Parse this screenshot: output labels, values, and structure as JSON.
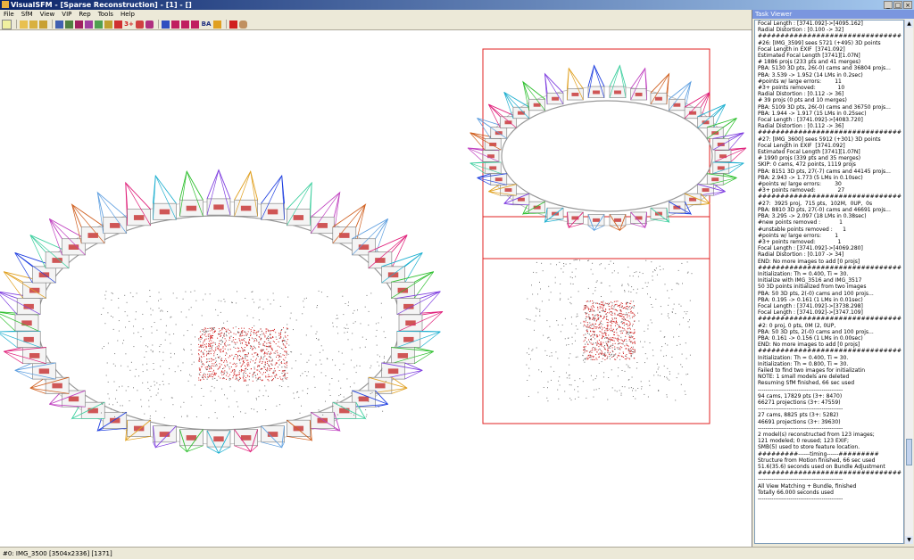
{
  "window": {
    "title": "VisualSFM - [Sparse Reconstruction] - [1] - []",
    "minimize_label": "_",
    "maximize_label": "□",
    "close_label": "×"
  },
  "menu": [
    "File",
    "SfM",
    "View",
    "VIP",
    "Rep",
    "Tools",
    "Help"
  ],
  "toolbar": {
    "icon_names": [
      "notepad-icon",
      "open-folder-icon",
      "open-multi-icon",
      "open-pairs-icon",
      "save-icon",
      "match-icon",
      "pair-icon",
      "camera-icon",
      "tag-icon",
      "lock-icon",
      "delete-icon",
      "reconstruct-plus-icon",
      "sparse-icon",
      "dense-icon",
      "shuffle-icon",
      "play-icon",
      "fast-forward-icon",
      "next-icon",
      "ba-icon",
      "compute-icon",
      "pause-icon",
      "hand-icon"
    ],
    "text_glyphs": {
      "reconstruct": "3+",
      "ba": "BA"
    }
  },
  "status_bar": {
    "text": "#0: IMG_3500 [3504x2336] [1371]"
  },
  "task_viewer": {
    "title": "Task Viewer",
    "log_lines": [
      "Focal Length : [3741.092]->[4095.162]",
      "Radial Distortion : [0.100 -> 32]",
      "",
      "################################",
      "#26: [IMG_3599] sees 5721 (+495) 3D points",
      "Focal Length in EXIF  [3741.092]",
      "Estimated Focal Length [3741][1.07N]",
      "# 1886 projs (233 pts and 41 merges)",
      "PBA: 5130 3D pts, 26(-0) cams and 36804 projs...",
      "PBA: 3.539 -> 1.952 (14 LMs in 0.2sec)",
      "#points w/ large errors:        11",
      "#3+ points removed:             10",
      "Radial Distortion : [0.112 -> 36]",
      "# 39 projs (0 pts and 10 merges)",
      "PBA: 5109 3D pts, 26(-0) cams and 36750 projs...",
      "PBA: 1.944 -> 1.917 (15 LMs in 0.25sec)",
      "Focal Length : [3741.092]->[4083.720]",
      "Radial Distortion : [0.112 -> 36]",
      "",
      "################################",
      "#27: [IMG_3600] sees 5912 (+301) 3D points",
      "Focal Length in EXIF  [3741.092]",
      "Estimated Focal Length [3741][1.07N]",
      "# 1990 projs (339 pts and 35 merges)",
      "SKIP: 0 cams, 472 points, 1119 projs",
      "PBA: 8151 3D pts, 27(-7) cams and 44145 projs...",
      "PBA: 2.943 -> 1.773 (5 LMs in 0.10sec)",
      "#points w/ large errors:        30",
      "#3+ points removed:             27",
      "################################",
      "#27:  3925 proj,  715 pts,  102M,  0UP,  0s",
      "PBA: 8810 3D pts, 27(-0) cams and 46691 projs...",
      "PBA: 3.295 -> 2.097 (18 LMs in 0.38sec)",
      "#new points removed :           1",
      "#unstable points removed :      1",
      "#points w/ large errors:        1",
      "#3+ points removed:             1",
      "Focal Length : [3741.092]->[4069.280]",
      "Radial Distortion : [0.107 -> 34]",
      "END: No more images to add [0 projs]",
      "",
      "################################",
      "Initialization: Th = 0.400, Ti = 30.",
      "Initialize with IMG_3516 and IMG_3517",
      "50 3D points initialized from two images",
      "PBA: 50 3D pts, 2(-0) cams and 100 projs...",
      "PBA: 0.195 -> 0.161 (1 LMs in 0.01sec)",
      "Focal Length : [3741.092]->[3738.298]",
      "Focal Length : [3741.092]->[3747.109]",
      "",
      "################################",
      "#2: 0 proj, 0 pts, 0M (2, 0UP,",
      "PBA: 50 3D pts, 2(-0) cams and 100 projs...",
      "PBA: 0.161 -> 0.156 (1 LMs in 0.00sec)",
      "END: No more images to add [0 projs]",
      "",
      "################################",
      "Initialization: Th = 0.400, Ti = 30.",
      "Initialization: Th = 0.800, Ti = 30.",
      "Failed to find two images for initializatin",
      "NOTE: 1 small models are deleted",
      "Resuming SfM finished, 66 sec used",
      "--------------------------------------------",
      "",
      "94 cams, 17829 pts (3+: 8470)",
      "66271 projections (3+: 47559)",
      "--------------------------------------------",
      "27 cams, 8825 pts (3+: 5282)",
      "46691 projections (3+: 39630)",
      "--------------------------------------------",
      "2 model(s) reconstructed from 123 images;",
      "121 modeled; 0 reused; 123 EXIF;",
      "SMB(5) used to store feature location.",
      "",
      "",
      "#########------timing------#########",
      "Structure from Motion finished, 66 sec used",
      "51.6(35.6) seconds used on Bundle Adjustment",
      "################################",
      "--------------------------------------------",
      "All View Matching + Bundle, finished",
      "Totally 66.000 seconds used",
      "--------------------------------------------"
    ]
  },
  "colors": {
    "title_bar": "#0a246a",
    "chrome": "#ece9d8",
    "bounding_box": "#e02020",
    "point_cloud": "#d02020",
    "camera_palette": [
      "#e0207a",
      "#20b0d0",
      "#30c030",
      "#8040e0",
      "#e0a020",
      "#2040e0",
      "#40d0a0",
      "#c040c0",
      "#d06020",
      "#60a0e0"
    ]
  }
}
